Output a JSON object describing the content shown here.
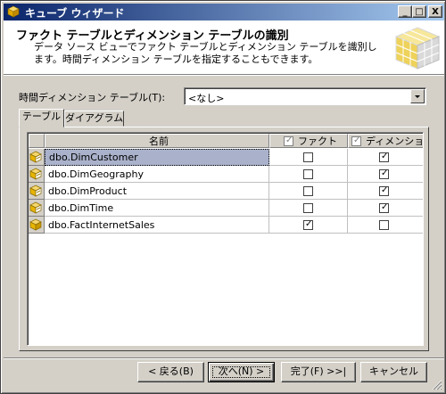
{
  "window": {
    "title": "キューブ ウィザード",
    "buttons": {
      "minimize": "_",
      "maximize": "□",
      "close": "X"
    }
  },
  "header": {
    "title": "ファクト テーブルとディメンション テーブルの識別",
    "description": "データ ソース ビューでファクト テーブルとディメンション テーブルを識別します。時間ディメンション テーブルを指定することもできます。",
    "icon": "cube-icon"
  },
  "time_dimension": {
    "label": "時間ディメンション テーブル(T):",
    "value": "<なし>"
  },
  "tabs": [
    {
      "label": "テーブル",
      "active": true
    },
    {
      "label": "ダイアグラム",
      "active": false
    }
  ],
  "grid": {
    "columns": {
      "name": "名前",
      "fact": "ファクト",
      "dimension": "ディメンション"
    },
    "rows": [
      {
        "name": "dbo.DimCustomer",
        "icon": "dimension-table-icon",
        "fact": false,
        "dimension": true,
        "selected": true
      },
      {
        "name": "dbo.DimGeography",
        "icon": "dimension-table-icon",
        "fact": false,
        "dimension": true,
        "selected": false
      },
      {
        "name": "dbo.DimProduct",
        "icon": "dimension-table-icon",
        "fact": false,
        "dimension": true,
        "selected": false
      },
      {
        "name": "dbo.DimTime",
        "icon": "dimension-table-icon",
        "fact": false,
        "dimension": true,
        "selected": false
      },
      {
        "name": "dbo.FactInternetSales",
        "icon": "fact-table-icon",
        "fact": true,
        "dimension": false,
        "selected": false
      }
    ]
  },
  "footer": {
    "back": "< 戻る(B)",
    "next": "次へ(N) >",
    "finish": "完了(F) >>|",
    "cancel": "キャンセル"
  }
}
